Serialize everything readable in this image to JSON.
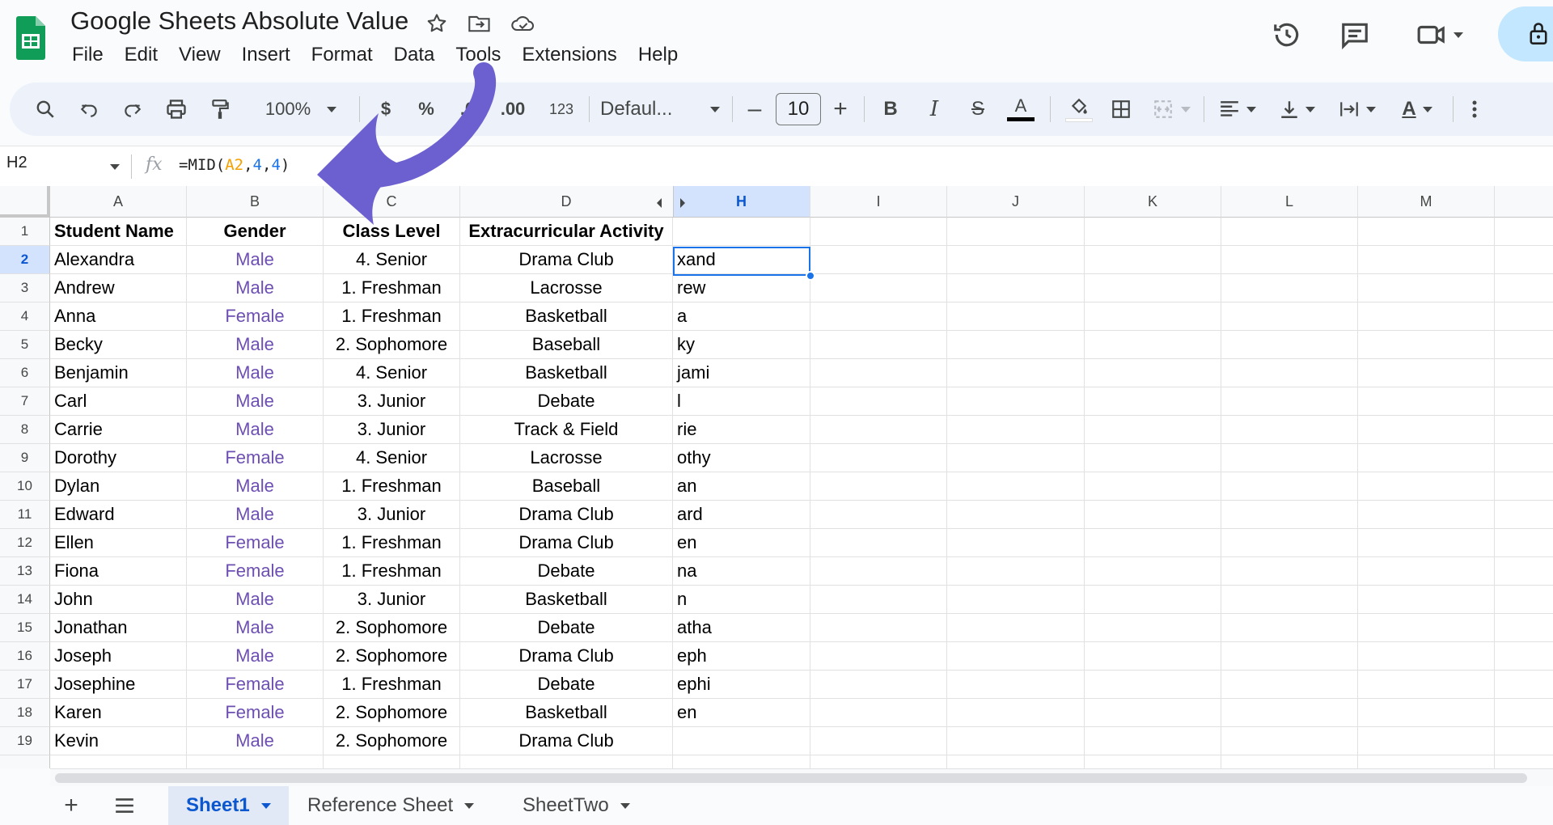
{
  "document": {
    "title": "Google Sheets Absolute Value"
  },
  "menu": [
    "File",
    "Edit",
    "View",
    "Insert",
    "Format",
    "Data",
    "Tools",
    "Extensions",
    "Help"
  ],
  "toolbar": {
    "zoom": "100%",
    "currency": "$",
    "percent": "%",
    "decrease_decimal": ".0",
    "increase_decimal": ".00",
    "number_format": "123",
    "font": "Defaul...",
    "font_size": "10",
    "bold": "B",
    "italic": "I",
    "strike": "S",
    "text_color": "A"
  },
  "formula_bar": {
    "name_box": "H2",
    "fx": "fx",
    "formula_prefix": "=MID(",
    "formula_ref": "A2",
    "formula_sep1": ",",
    "formula_arg1": "4",
    "formula_sep2": ",",
    "formula_arg2": "4",
    "formula_suffix": ")"
  },
  "columns": [
    {
      "label": "A",
      "selected": false
    },
    {
      "label": "B",
      "selected": false
    },
    {
      "label": "C",
      "selected": false
    },
    {
      "label": "D",
      "selected": false
    },
    {
      "label": "H",
      "selected": true
    },
    {
      "label": "I",
      "selected": false
    },
    {
      "label": "J",
      "selected": false
    },
    {
      "label": "K",
      "selected": false
    },
    {
      "label": "L",
      "selected": false
    },
    {
      "label": "M",
      "selected": false
    }
  ],
  "table": {
    "headers": [
      "Student Name",
      "Gender",
      "Class Level",
      "Extracurricular Activity"
    ],
    "rows": [
      {
        "num": "2",
        "name": "Alexandra",
        "gender": "Male",
        "level": "4. Senior",
        "activity": "Drama Club",
        "h": "xand"
      },
      {
        "num": "3",
        "name": "Andrew",
        "gender": "Male",
        "level": "1. Freshman",
        "activity": "Lacrosse",
        "h": "rew"
      },
      {
        "num": "4",
        "name": "Anna",
        "gender": "Female",
        "level": "1. Freshman",
        "activity": "Basketball",
        "h": "a"
      },
      {
        "num": "5",
        "name": "Becky",
        "gender": "Male",
        "level": "2. Sophomore",
        "activity": "Baseball",
        "h": "ky"
      },
      {
        "num": "6",
        "name": "Benjamin",
        "gender": "Male",
        "level": "4. Senior",
        "activity": "Basketball",
        "h": "jami"
      },
      {
        "num": "7",
        "name": "Carl",
        "gender": "Male",
        "level": "3. Junior",
        "activity": "Debate",
        "h": "l"
      },
      {
        "num": "8",
        "name": "Carrie",
        "gender": "Male",
        "level": "3. Junior",
        "activity": "Track & Field",
        "h": "rie"
      },
      {
        "num": "9",
        "name": "Dorothy",
        "gender": "Female",
        "level": "4. Senior",
        "activity": "Lacrosse",
        "h": "othy"
      },
      {
        "num": "10",
        "name": "Dylan",
        "gender": "Male",
        "level": "1. Freshman",
        "activity": "Baseball",
        "h": "an"
      },
      {
        "num": "11",
        "name": "Edward",
        "gender": "Male",
        "level": "3. Junior",
        "activity": "Drama Club",
        "h": "ard"
      },
      {
        "num": "12",
        "name": "Ellen",
        "gender": "Female",
        "level": "1. Freshman",
        "activity": "Drama Club",
        "h": "en"
      },
      {
        "num": "13",
        "name": "Fiona",
        "gender": "Female",
        "level": "1. Freshman",
        "activity": "Debate",
        "h": "na"
      },
      {
        "num": "14",
        "name": "John",
        "gender": "Male",
        "level": "3. Junior",
        "activity": "Basketball",
        "h": "n"
      },
      {
        "num": "15",
        "name": "Jonathan",
        "gender": "Male",
        "level": "2. Sophomore",
        "activity": "Debate",
        "h": "atha"
      },
      {
        "num": "16",
        "name": "Joseph",
        "gender": "Male",
        "level": "2. Sophomore",
        "activity": "Drama Club",
        "h": "eph"
      },
      {
        "num": "17",
        "name": "Josephine",
        "gender": "Female",
        "level": "1. Freshman",
        "activity": "Debate",
        "h": "ephi"
      },
      {
        "num": "18",
        "name": "Karen",
        "gender": "Female",
        "level": "2. Sophomore",
        "activity": "Basketball",
        "h": "en"
      },
      {
        "num": "19",
        "name": "Kevin",
        "gender": "Male",
        "level": "2. Sophomore",
        "activity": "Drama Club",
        "h": ""
      }
    ],
    "selected_cell": "H2"
  },
  "sheets": [
    {
      "name": "Sheet1",
      "active": true
    },
    {
      "name": "Reference Sheet",
      "active": false
    },
    {
      "name": "SheetTwo",
      "active": false
    }
  ],
  "colors": {
    "accent": "#1a73e8",
    "gender_text": "#6d4fb3",
    "arrow": "#6c5fcf",
    "logo": "#0f9d58"
  },
  "icons": [
    "sheets-logo-icon",
    "star-icon",
    "move-folder-icon",
    "cloud-status-icon",
    "history-icon",
    "comment-icon",
    "meet-icon",
    "lock-icon",
    "search-icon",
    "undo-icon",
    "redo-icon",
    "print-icon",
    "paint-format-icon",
    "fill-color-icon",
    "borders-icon",
    "merge-icon",
    "align-icon",
    "valign-icon",
    "wrap-icon",
    "rotate-icon",
    "more-icon",
    "add-sheet-icon",
    "all-sheets-icon"
  ]
}
